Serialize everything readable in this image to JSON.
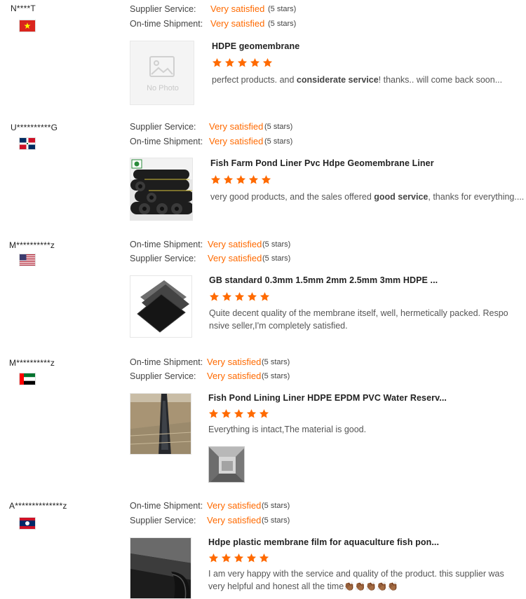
{
  "reviews": [
    {
      "buyer": "N****T",
      "flag": "vietnam",
      "rows": [
        {
          "label": "Supplier Service:",
          "value": "Very satisfied",
          "stars": "(5 stars)"
        },
        {
          "label": "On-time Shipment:",
          "value": "Very satisfied",
          "stars": "(5 stars)"
        }
      ],
      "thumb_placeholder": "No Photo",
      "product": "HDPE geomembrane",
      "rating": 5,
      "comment_parts": [
        "perfect products. and ",
        "considerate service",
        "! thanks.. will come back soon..."
      ]
    },
    {
      "buyer": "U**********G",
      "flag": "dominican-republic",
      "rows": [
        {
          "label": "Supplier Service:",
          "value": "Very satisfied",
          "stars": "(5 stars)"
        },
        {
          "label": "On-time Shipment:",
          "value": "Very satisfied",
          "stars": "(5 stars)"
        }
      ],
      "product": "Fish Farm Pond Liner Pvc Hdpe Geomembrane Liner",
      "rating": 5,
      "comment_parts": [
        "very good products, and the sales offered ",
        "good service",
        ", thanks for everything...."
      ]
    },
    {
      "buyer": "M**********z",
      "flag": "usa",
      "rows": [
        {
          "label": "On-time Shipment:",
          "value": "Very satisfied",
          "stars": "(5 stars)"
        },
        {
          "label": "Supplier Service:",
          "value": "Very satisfied",
          "stars": "(5 stars)"
        }
      ],
      "product": "GB standard 0.3mm 1.5mm 2mm 2.5mm 3mm HDPE ...",
      "rating": 5,
      "comment": "Quite decent quality of the membrane itself, well, hermetically packed. Responsive seller,I'm completely satisfied."
    },
    {
      "buyer": "M**********z",
      "flag": "uae",
      "rows": [
        {
          "label": "On-time Shipment:",
          "value": "Very satisfied",
          "stars": "(5 stars)"
        },
        {
          "label": "Supplier Service:",
          "value": "Very satisfied",
          "stars": "(5 stars)"
        }
      ],
      "product": "Fish Pond Lining Liner HDPE EPDM PVC Water Reserv...",
      "rating": 5,
      "comment": "Everything is intact,The material is good."
    },
    {
      "buyer": "A**************z",
      "flag": "laos",
      "rows": [
        {
          "label": "On-time Shipment:",
          "value": "Very satisfied",
          "stars": "(5 stars)"
        },
        {
          "label": "Supplier Service:",
          "value": "Very satisfied",
          "stars": "(5 stars)"
        }
      ],
      "product": "Hdpe plastic membrane film for aquaculture fish pon...",
      "rating": 5,
      "comment": "I am very happy with the service and quality of the product. this supplier was very helpful and honest all the time",
      "comment_emoji": "👏🏾👏🏾👏🏾👏🏾👏🏾"
    }
  ],
  "colors": {
    "accent": "#ff6a00",
    "text": "#333333",
    "muted": "#555555"
  },
  "icons": {
    "star": "star-icon",
    "no_photo": "image-placeholder-icon"
  }
}
